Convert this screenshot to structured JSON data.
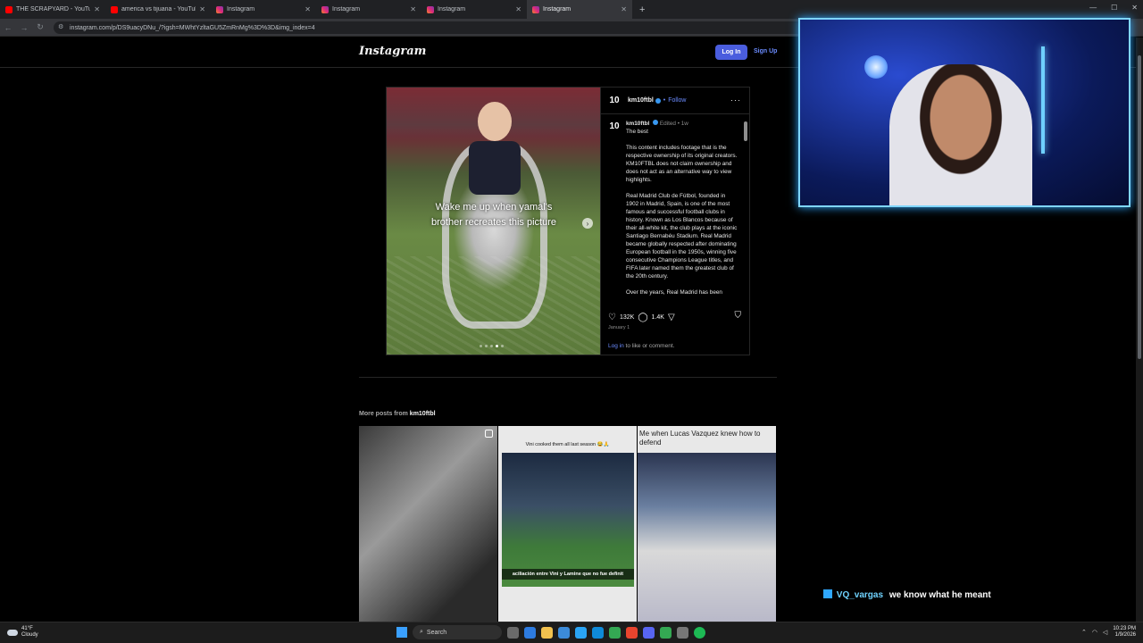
{
  "browser": {
    "tabs": [
      {
        "title": "THE SCRAPYARD - YouTube",
        "icon": "youtube-icon",
        "active": false
      },
      {
        "title": "america vs tijuana - YouTube",
        "icon": "youtube-icon",
        "active": false
      },
      {
        "title": "Instagram",
        "icon": "instagram-icon",
        "active": false
      },
      {
        "title": "Instagram",
        "icon": "instagram-icon",
        "active": false
      },
      {
        "title": "Instagram",
        "icon": "instagram-icon",
        "active": false
      },
      {
        "title": "Instagram",
        "icon": "instagram-icon",
        "active": true
      }
    ],
    "new_tab": "+",
    "url": "instagram.com/p/DS9uacyDNu_/?igsh=MWhtYzltaGU5ZmRnMg%3D%3D&img_index=4"
  },
  "instagram": {
    "logo": "Instagram",
    "login_label": "Log In",
    "signup_label": "Sign Up"
  },
  "post": {
    "account_avatar": "10",
    "username": "km10ftbl",
    "follow_label": "Follow",
    "follow_sep": "•",
    "more_label": "···",
    "media_caption": "Wake me up when yamal's brother recreates this picture",
    "carousel_index": 4,
    "caption_meta": "Edited • 1w",
    "caption_title": "The best",
    "caption_paragraphs": [
      "This content includes footage that is the respective ownership of its original creators. KM10FTBL does not claim ownership and does not act as an alternative way to view highlights.",
      "Real Madrid Club de Fútbol, founded in 1902 in Madrid, Spain, is one of the most famous and successful football clubs in history. Known as Los Blancos because of their all-white kit, the club plays at the iconic Santiago Bernabéu Stadium. Real Madrid became globally respected after dominating European football in the 1950s, winning five consecutive Champions League titles, and FIFA later named them the greatest club of the 20th century.",
      "Over the years, Real Madrid has been"
    ],
    "likes": "132K",
    "comments": "1.4K",
    "date": "January 1",
    "login_link": "Log in",
    "login_suffix": "to like or comment."
  },
  "more_posts": {
    "title_prefix": "More posts from",
    "username": "km10ftbl",
    "items": [
      {
        "caption": ""
      },
      {
        "caption": "Vini cooked them all last season 😂🙏",
        "subtitle": "aciliación entre Vini y Lamine que no fue definit"
      },
      {
        "caption": "Me when Lucas Vazquez knew how to defend"
      }
    ]
  },
  "overlay": {
    "chat_user": "VQ_vargas",
    "chat_message": "we know what he meant"
  },
  "taskbar": {
    "temperature": "41°F",
    "condition": "Cloudy",
    "search_label": "Search",
    "time": "10:23 PM",
    "date": "1/9/2026"
  }
}
